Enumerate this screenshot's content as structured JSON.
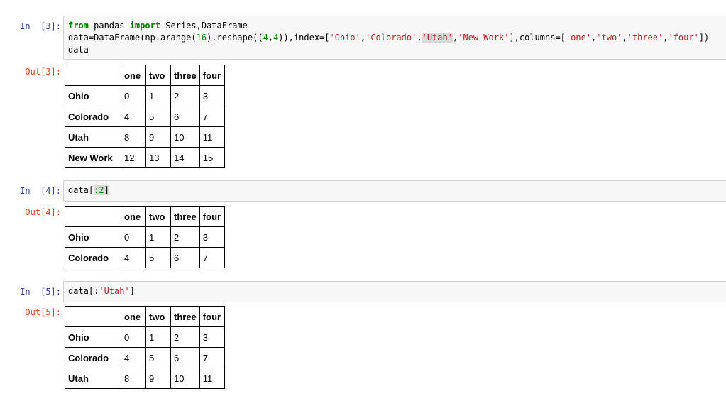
{
  "cells": [
    {
      "in_prompt": "In  [3]:",
      "out_prompt": "Out[3]:",
      "code_lines": {
        "l1_kw1": "from",
        "l1_t1": " pandas ",
        "l1_kw2": "import",
        "l1_t2": " Series,DataFrame",
        "l2_a": "data=DataFrame(np.arange(",
        "l2_n1": "16",
        "l2_b": ").reshape((",
        "l2_n2": "4",
        "l2_c": ",",
        "l2_n3": "4",
        "l2_d": ")),index=[",
        "l2_s1": "'Ohio'",
        "l2_e": ",",
        "l2_s2": "'Colorado'",
        "l2_f": ",",
        "l2_s3": "'Utah'",
        "l2_g": ",",
        "l2_s4": "'New Work'",
        "l2_h": "],columns=[",
        "l2_s5": "'one'",
        "l2_i": ",",
        "l2_s6": "'two'",
        "l2_j": ",",
        "l2_s7": "'three'",
        "l2_k": ",",
        "l2_s8": "'four'",
        "l2_l": "])",
        "l3": "data"
      },
      "table": {
        "columns": [
          "one",
          "two",
          "three",
          "four"
        ],
        "rows": [
          {
            "index": "Ohio",
            "values": [
              "0",
              "1",
              "2",
              "3"
            ]
          },
          {
            "index": "Colorado",
            "values": [
              "4",
              "5",
              "6",
              "7"
            ]
          },
          {
            "index": "Utah",
            "values": [
              "8",
              "9",
              "10",
              "11"
            ]
          },
          {
            "index": "New Work",
            "values": [
              "12",
              "13",
              "14",
              "15"
            ]
          }
        ]
      }
    },
    {
      "in_prompt": "In  [4]:",
      "out_prompt": "Out[4]:",
      "code_lines": {
        "a": "data[",
        "n": ":2",
        "b": "]"
      },
      "table": {
        "columns": [
          "one",
          "two",
          "three",
          "four"
        ],
        "rows": [
          {
            "index": "Ohio",
            "values": [
              "0",
              "1",
              "2",
              "3"
            ]
          },
          {
            "index": "Colorado",
            "values": [
              "4",
              "5",
              "6",
              "7"
            ]
          }
        ]
      }
    },
    {
      "in_prompt": "In  [5]:",
      "out_prompt": "Out[5]:",
      "code_lines": {
        "a": "data[:",
        "s": "'Utah'",
        "b": "]"
      },
      "table": {
        "columns": [
          "one",
          "two",
          "three",
          "four"
        ],
        "rows": [
          {
            "index": "Ohio",
            "values": [
              "0",
              "1",
              "2",
              "3"
            ]
          },
          {
            "index": "Colorado",
            "values": [
              "4",
              "5",
              "6",
              "7"
            ]
          },
          {
            "index": "Utah",
            "values": [
              "8",
              "9",
              "10",
              "11"
            ]
          }
        ]
      }
    }
  ]
}
